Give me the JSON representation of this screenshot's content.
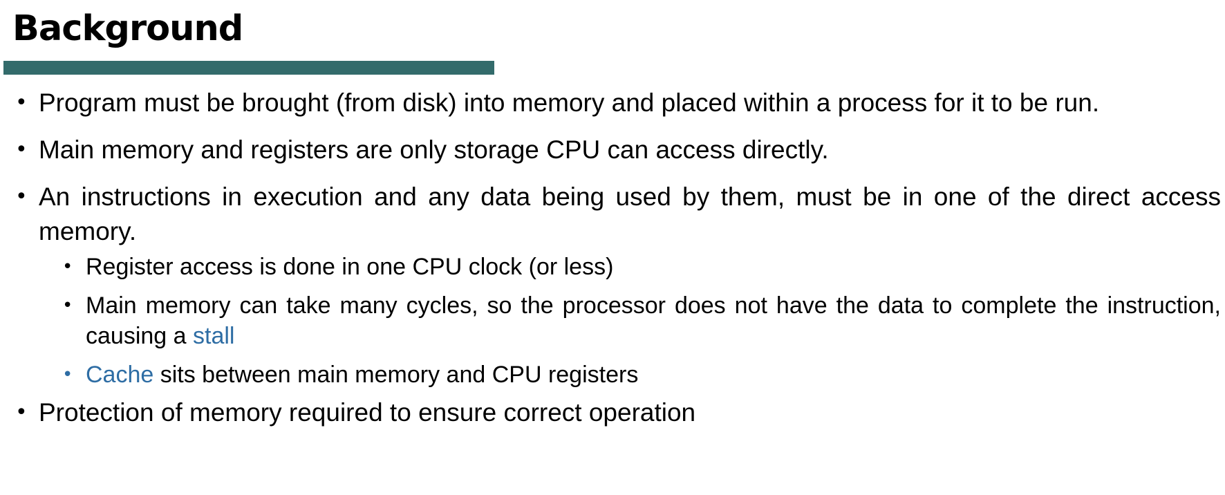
{
  "slide": {
    "title": "Background",
    "accent_color": "#336b6b",
    "link_color": "#2e6da4",
    "bullets": [
      {
        "text": "Program must be brought (from disk) into memory and placed within a process for it to be run."
      },
      {
        "text": "Main memory and registers are only storage CPU can access directly."
      },
      {
        "text": "An instructions in execution and any data being used by them, must be in one of the direct access memory.",
        "sub": [
          {
            "text": "Register access is done in one CPU clock (or less)"
          },
          {
            "text_before": "Main memory can take many cycles, so the processor does not have the data to complete the instruction, causing a ",
            "highlight": "stall"
          },
          {
            "highlight": "Cache",
            "text_after": " sits between main memory and CPU registers"
          }
        ]
      },
      {
        "text": "Protection of memory required to ensure correct operation"
      }
    ]
  }
}
